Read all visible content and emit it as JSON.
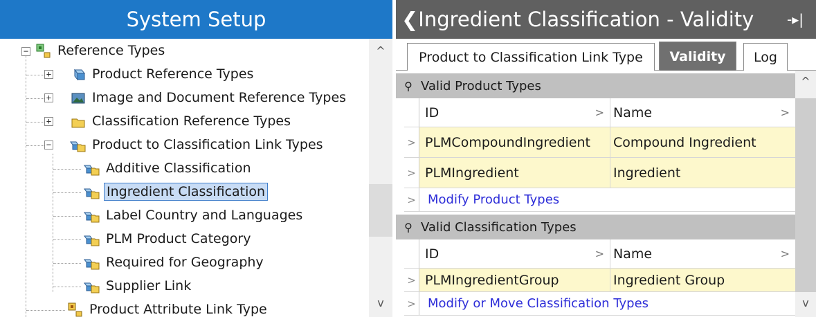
{
  "left_panel": {
    "title": "System Setup",
    "tree": [
      {
        "label": "Reference Types",
        "expander": "−"
      },
      {
        "label": "Product Reference Types",
        "expander": "+"
      },
      {
        "label": "Image and Document Reference Types",
        "expander": "+"
      },
      {
        "label": "Classification Reference Types",
        "expander": "+"
      },
      {
        "label": "Product to Classification Link Types",
        "expander": "−"
      },
      {
        "label": "Additive Classification"
      },
      {
        "label": "Ingredient Classification",
        "selected": true
      },
      {
        "label": "Label Country and Languages"
      },
      {
        "label": "PLM Product Category"
      },
      {
        "label": "Required for Geography"
      },
      {
        "label": "Supplier Link"
      },
      {
        "label": "Product Attribute Link Type"
      }
    ],
    "scroll_up": "^",
    "scroll_down": "v"
  },
  "right_panel": {
    "title": "❮Ingredient Classification - Validity",
    "pin_icon": "-▸|",
    "tabs": [
      {
        "label": "Product to Classification Link Type"
      },
      {
        "label": "Validity",
        "active": true
      },
      {
        "label": "Log"
      }
    ],
    "sections": [
      {
        "title": "Valid Product Types",
        "columns": [
          "ID",
          "Name"
        ],
        "rows": [
          {
            "id": "PLMCompoundIngredient",
            "name": "Compound Ingredient"
          },
          {
            "id": "PLMIngredient",
            "name": "Ingredient"
          }
        ],
        "action": "Modify Product Types"
      },
      {
        "title": "Valid Classification Types",
        "columns": [
          "ID",
          "Name"
        ],
        "rows": [
          {
            "id": "PLMIngredientGroup",
            "name": "Ingredient Group"
          }
        ],
        "action": "Modify or Move Classification Types"
      }
    ],
    "row_marker": ">",
    "scroll_up": "^",
    "scroll_down": "v"
  },
  "colors": {
    "left_title_bg": "#1e78c8",
    "right_title_bg": "#606060",
    "row_highlight": "#fdf8cc",
    "link": "#2d2dd8"
  }
}
